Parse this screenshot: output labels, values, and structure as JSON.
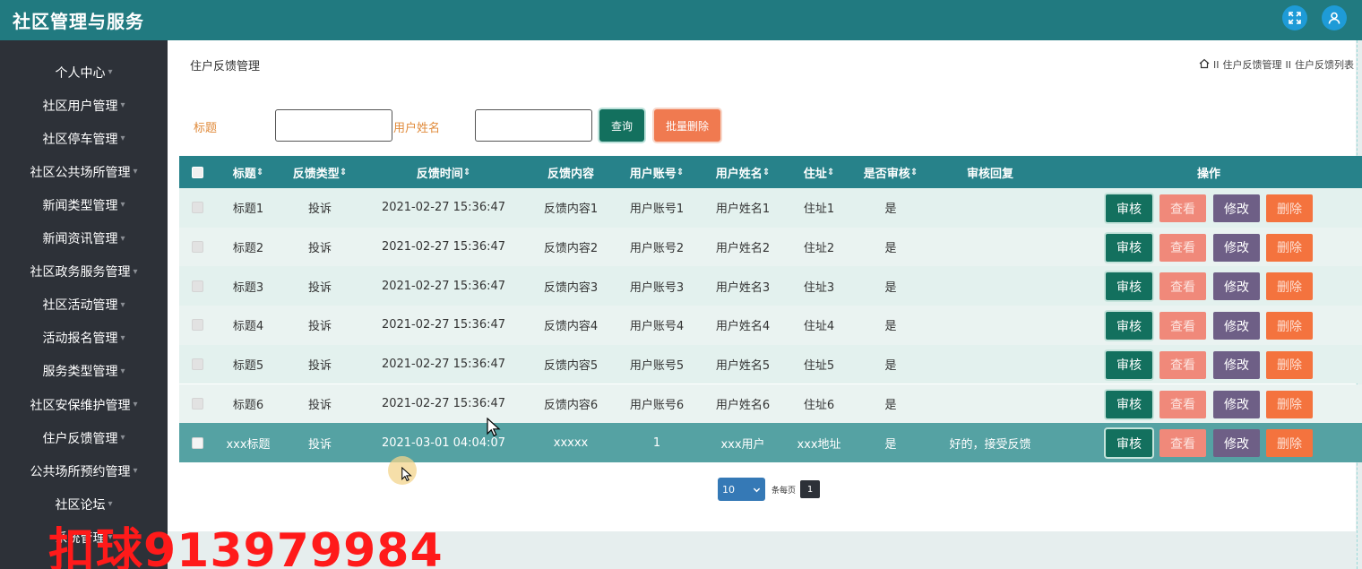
{
  "app": {
    "title": "社区管理与服务"
  },
  "topbar": {
    "fullscreen_icon": "fullscreen-icon",
    "user_icon": "user-icon"
  },
  "sidebar": {
    "items": [
      {
        "label": "个人中心"
      },
      {
        "label": "社区用户管理"
      },
      {
        "label": "社区停车管理"
      },
      {
        "label": "社区公共场所管理"
      },
      {
        "label": "新闻类型管理"
      },
      {
        "label": "新闻资讯管理"
      },
      {
        "label": "社区政务服务管理"
      },
      {
        "label": "社区活动管理"
      },
      {
        "label": "活动报名管理"
      },
      {
        "label": "服务类型管理"
      },
      {
        "label": "社区安保维护管理"
      },
      {
        "label": "住户反馈管理"
      },
      {
        "label": "公共场所预约管理"
      },
      {
        "label": "社区论坛"
      },
      {
        "label": "系统管理"
      }
    ]
  },
  "page": {
    "heading": "住户反馈管理",
    "breadcrumb": [
      "住户反馈管理",
      "住户反馈列表"
    ],
    "breadcrumb_sep": "II"
  },
  "search": {
    "title_label": "标题",
    "title_value": "",
    "username_label": "用户姓名",
    "username_value": "",
    "query_button": "查询",
    "batch_delete_button": "批量删除"
  },
  "table": {
    "headers": [
      "标题",
      "反馈类型",
      "反馈时间",
      "反馈内容",
      "用户账号",
      "用户姓名",
      "住址",
      "是否审核",
      "审核回复",
      "操作"
    ],
    "sort_mark": "⇕",
    "rows": [
      [
        "标题1",
        "投诉",
        "2021-02-27 15:36:47",
        "反馈内容1",
        "用户账号1",
        "用户姓名1",
        "住址1",
        "是",
        ""
      ],
      [
        "标题2",
        "投诉",
        "2021-02-27 15:36:47",
        "反馈内容2",
        "用户账号2",
        "用户姓名2",
        "住址2",
        "是",
        ""
      ],
      [
        "标题3",
        "投诉",
        "2021-02-27 15:36:47",
        "反馈内容3",
        "用户账号3",
        "用户姓名3",
        "住址3",
        "是",
        ""
      ],
      [
        "标题4",
        "投诉",
        "2021-02-27 15:36:47",
        "反馈内容4",
        "用户账号4",
        "用户姓名4",
        "住址4",
        "是",
        ""
      ],
      [
        "标题5",
        "投诉",
        "2021-02-27 15:36:47",
        "反馈内容5",
        "用户账号5",
        "用户姓名5",
        "住址5",
        "是",
        ""
      ],
      [
        "标题6",
        "投诉",
        "2021-02-27 15:36:47",
        "反馈内容6",
        "用户账号6",
        "用户姓名6",
        "住址6",
        "是",
        ""
      ],
      [
        "xxx标题",
        "投诉",
        "2021-03-01 04:04:07",
        "xxxxx",
        "1",
        "xxx用户",
        "xxx地址",
        "是",
        "好的，接受反馈"
      ]
    ],
    "actions": [
      "审核",
      "查看",
      "修改",
      "删除"
    ],
    "selected_row": 6
  },
  "pagination": {
    "page_size": "10",
    "per_page_label": "条每页",
    "current_page": "1"
  },
  "watermark": {
    "text": "扣球913979984"
  },
  "colors": {
    "header_bg": "#217a80",
    "sidebar_bg": "#2d3138",
    "table_header_bg": "#27828a",
    "row_odd": "#e3f1ee",
    "row_even": "#eaf3f1",
    "row_selected": "#55a2a3",
    "review_btn": "#13705e",
    "view_btn": "#f0897a",
    "edit_btn": "#6e5f86",
    "delete_btn": "#f4733e"
  }
}
